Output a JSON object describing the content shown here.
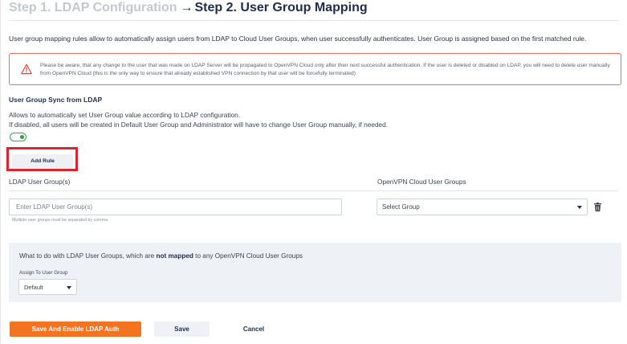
{
  "breadcrumb": {
    "step1": "Step 1. LDAP Configuration",
    "separator": "→",
    "step2": "Step 2. User Group Mapping"
  },
  "intro_text": "User group mapping rules allow to automatically assign users from LDAP to Cloud User Groups, when user successfully authenticates. User Group is assigned based on the first matched rule.",
  "alert": {
    "icon": "warning-icon",
    "text": "Please be aware, that any change to the user that was made on LDAP Server will be propagated to OpenVPN Cloud only after their next successful authentication. If the user is deleted or disabled on LDAP, you will need to delete user manually from OpenVPN Cloud (this is the only way to ensure that already established VPN connection by that user will be forcefully terminated)"
  },
  "sync": {
    "title": "User Group Sync from LDAP",
    "description_line1": "Allows to automatically set User Group value according to LDAP configuration.",
    "description_line2": "If disabled, all users will be created in Default User Group and Administrator will have to change User Group manually, if needed.",
    "enabled": true
  },
  "add_rule_label": "Add Rule",
  "mapping": {
    "ldap_column_label": "LDAP User Group(s)",
    "cloud_column_label": "OpenVPN Cloud User Groups",
    "ldap_input_value": "",
    "ldap_input_placeholder": "Enter LDAP User Group(s)",
    "ldap_input_hint": "Multiple user groups must be separated by comma",
    "cloud_select_value": "Select Group",
    "delete_icon": "trash-icon"
  },
  "unmapped": {
    "text_before": "What to do with LDAP User Groups, which are ",
    "text_bold": "not mapped",
    "text_after": " to any OpenVPN Cloud User Groups",
    "assign_label": "Assign To User Group",
    "assign_value": "Default"
  },
  "actions": {
    "primary_label": "Save And Enable LDAP Auth",
    "save_label": "Save",
    "cancel_label": "Cancel"
  },
  "colors": {
    "accent": "#f37321",
    "toggle_on": "#3aa34b",
    "alert_border": "#e56f66",
    "highlight": "#e0212e",
    "heading": "#1f2d4d"
  }
}
